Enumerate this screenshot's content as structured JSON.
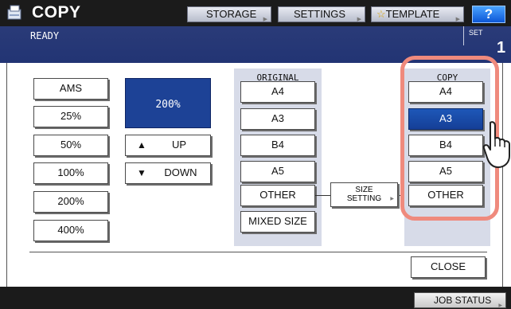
{
  "header": {
    "title": "COPY",
    "icon": "copy-icon",
    "tabs": [
      {
        "label": "STORAGE"
      },
      {
        "label": "SETTINGS"
      },
      {
        "label": "TEMPLATE",
        "icon": "star-icon"
      }
    ],
    "help_label": "?"
  },
  "status": {
    "text": "READY",
    "set_label": "SET",
    "set_count": "1"
  },
  "zoom": {
    "presets": [
      "AMS",
      "25%",
      "50%",
      "100%",
      "200%",
      "400%"
    ],
    "display_value": "200%",
    "up_label": "UP",
    "down_label": "DOWN"
  },
  "original": {
    "heading": "ORIGINAL",
    "sizes": [
      "A4",
      "A3",
      "B4",
      "A5",
      "OTHER",
      "MIXED SIZE"
    ]
  },
  "size_setting": {
    "line1": "SIZE",
    "line2": "SETTING"
  },
  "copy": {
    "heading": "COPY",
    "sizes": [
      "A4",
      "A3",
      "B4",
      "A5",
      "OTHER"
    ],
    "selected": "A3"
  },
  "footer": {
    "close_label": "CLOSE",
    "job_status_label": "JOB STATUS"
  },
  "colors": {
    "accent": "#1d4296",
    "highlight": "#ef8a7d",
    "status_bar": "#223474"
  }
}
